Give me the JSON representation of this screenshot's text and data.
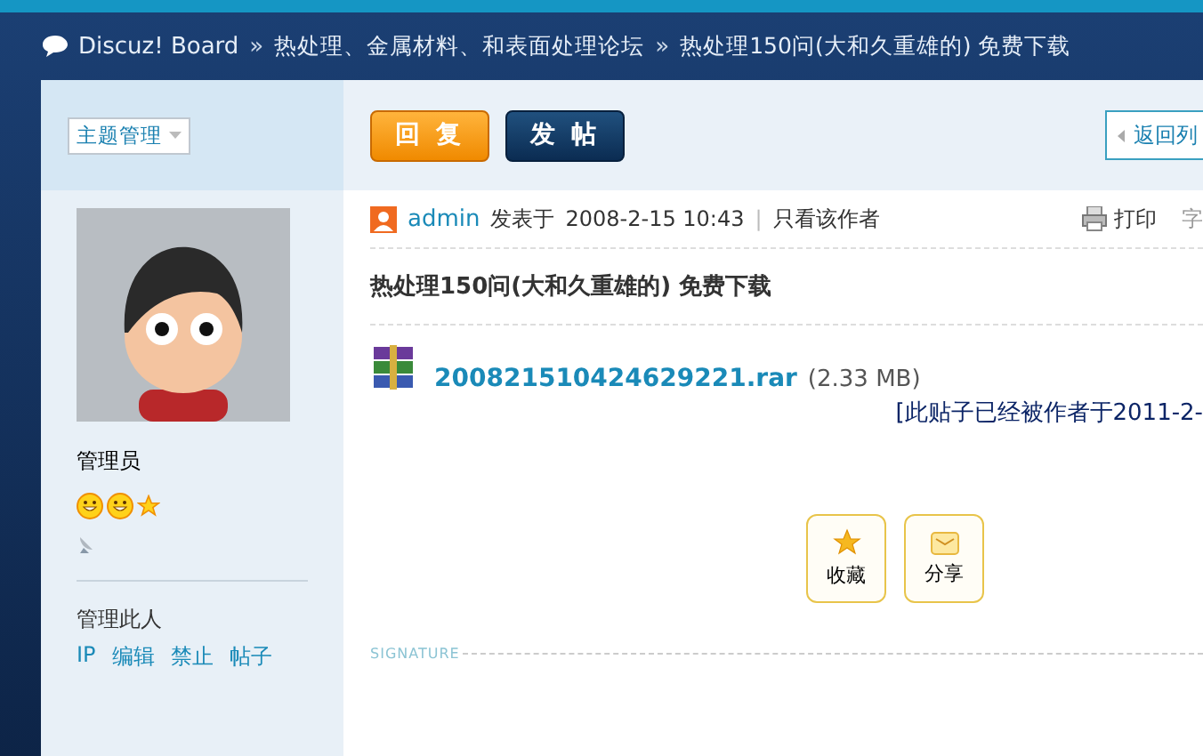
{
  "breadcrumb": {
    "items": [
      "Discuz! Board",
      "热处理、金属材料、和表面处理论坛",
      "热处理150问(大和久重雄的) 免费下载"
    ],
    "separator": "»"
  },
  "toolbar": {
    "manage_dropdown": "主题管理",
    "buttons": [
      {
        "label": "回 复",
        "kind": "reply"
      },
      {
        "label": "发 帖",
        "kind": "post"
      }
    ],
    "back_link": "返回列"
  },
  "author": {
    "group": "管理员",
    "links_title": "管理此人",
    "links": [
      "IP",
      "编辑",
      "禁止",
      "帖子"
    ]
  },
  "post": {
    "author": "admin",
    "posted_label": "发表于",
    "date": "2008-2-15 10:43",
    "divider": "|",
    "only_author": "只看该作者",
    "print": "打印",
    "font_label": "字",
    "title": "热处理150问(大和久重雄的) 免费下载",
    "attachment": {
      "name": "200821510424629221.rar",
      "size": "(2.33 MB)"
    },
    "edit_note": "[此贴子已经被作者于2011-2-",
    "actions": [
      {
        "label": "收藏",
        "kind": "favorite"
      },
      {
        "label": "分享",
        "kind": "share"
      }
    ],
    "signature_label": "SIGNATURE"
  }
}
